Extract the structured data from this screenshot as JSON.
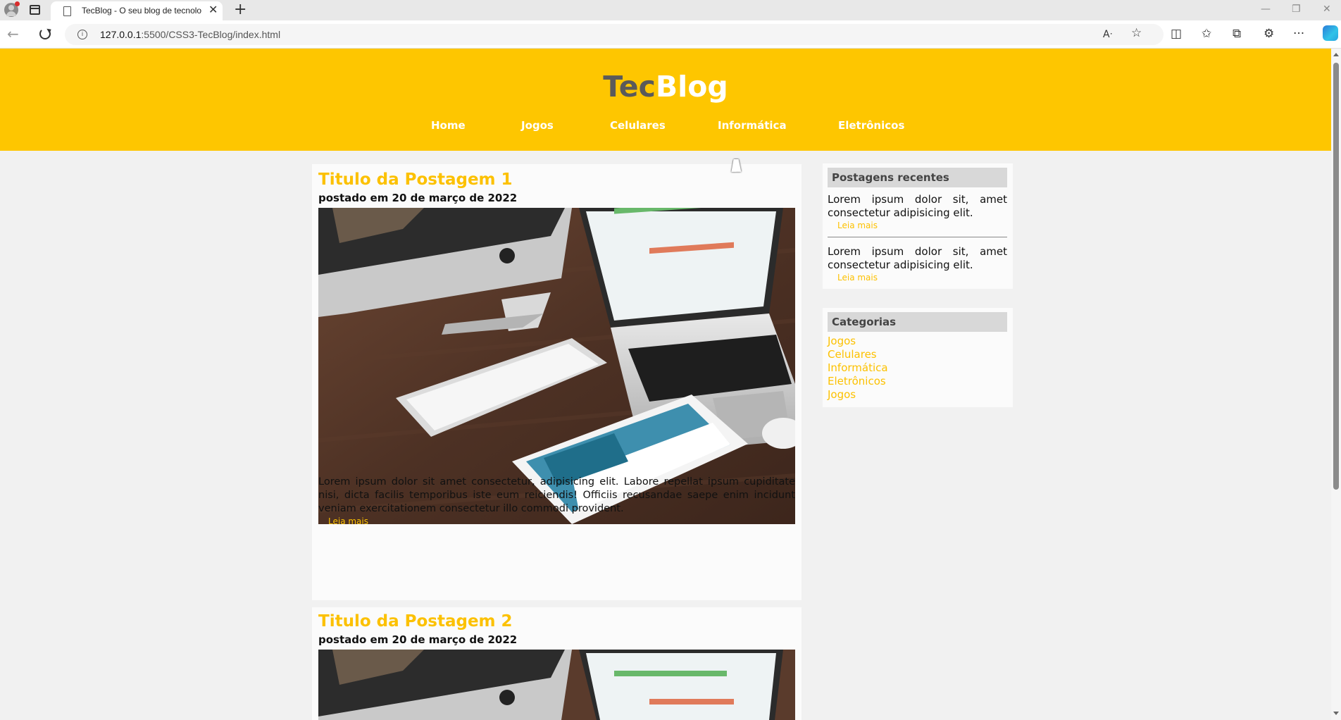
{
  "browser": {
    "tab_title": "TecBlog - O seu blog de tecnolog",
    "tab_close": "✕",
    "new_tab": "+",
    "url_host": "127.0.0.1",
    "url_path": ":5500/CSS3-TecBlog/index.html",
    "info_glyph": "i",
    "back_glyph": "←",
    "minimize_glyph": "—",
    "restore_glyph": "❐",
    "close_glyph": "✕",
    "read_aloud_glyph": "Aᐧ",
    "favorite_glyph": "☆",
    "split_glyph": "◫",
    "favorites_glyph": "✩",
    "collections_glyph": "⧉",
    "extensions_glyph": "⚙",
    "more_glyph": "···"
  },
  "site": {
    "logo_part1": "Tec",
    "logo_part2": "Blog",
    "colors": {
      "header": "#fec600",
      "accent": "#fcc100",
      "logo_dark": "#5a5a5a"
    },
    "nav": [
      "Home",
      "Jogos",
      "Celulares",
      "Informática",
      "Eletrônicos"
    ]
  },
  "posts": [
    {
      "title": "Titulo da Postagem 1",
      "date": "postado em 20 de março de 2022",
      "text": "Lorem ipsum dolor sit amet consectetur, adipisicing elit. Labore repellat ipsum cupiditate nisi, dicta facilis temporibus iste eum reiciendis! Officiis recusandae saepe enim incidunt veniam exercitationem consectetur illo commodi provident.",
      "read_more": "Leia mais"
    },
    {
      "title": "Titulo da Postagem 2",
      "date": "postado em 20 de março de 2022"
    }
  ],
  "sidebar": {
    "recent": {
      "title": "Postagens recentes",
      "items": [
        {
          "text": "Lorem ipsum dolor sit, amet consectetur adipisicing elit.",
          "link": "Leia mais"
        },
        {
          "text": "Lorem ipsum dolor sit, amet consectetur adipisicing elit.",
          "link": "Leia mais"
        }
      ]
    },
    "categories": {
      "title": "Categorias",
      "items": [
        "Jogos",
        "Celulares",
        "Informática",
        "Eletrônicos",
        "Jogos"
      ]
    }
  }
}
